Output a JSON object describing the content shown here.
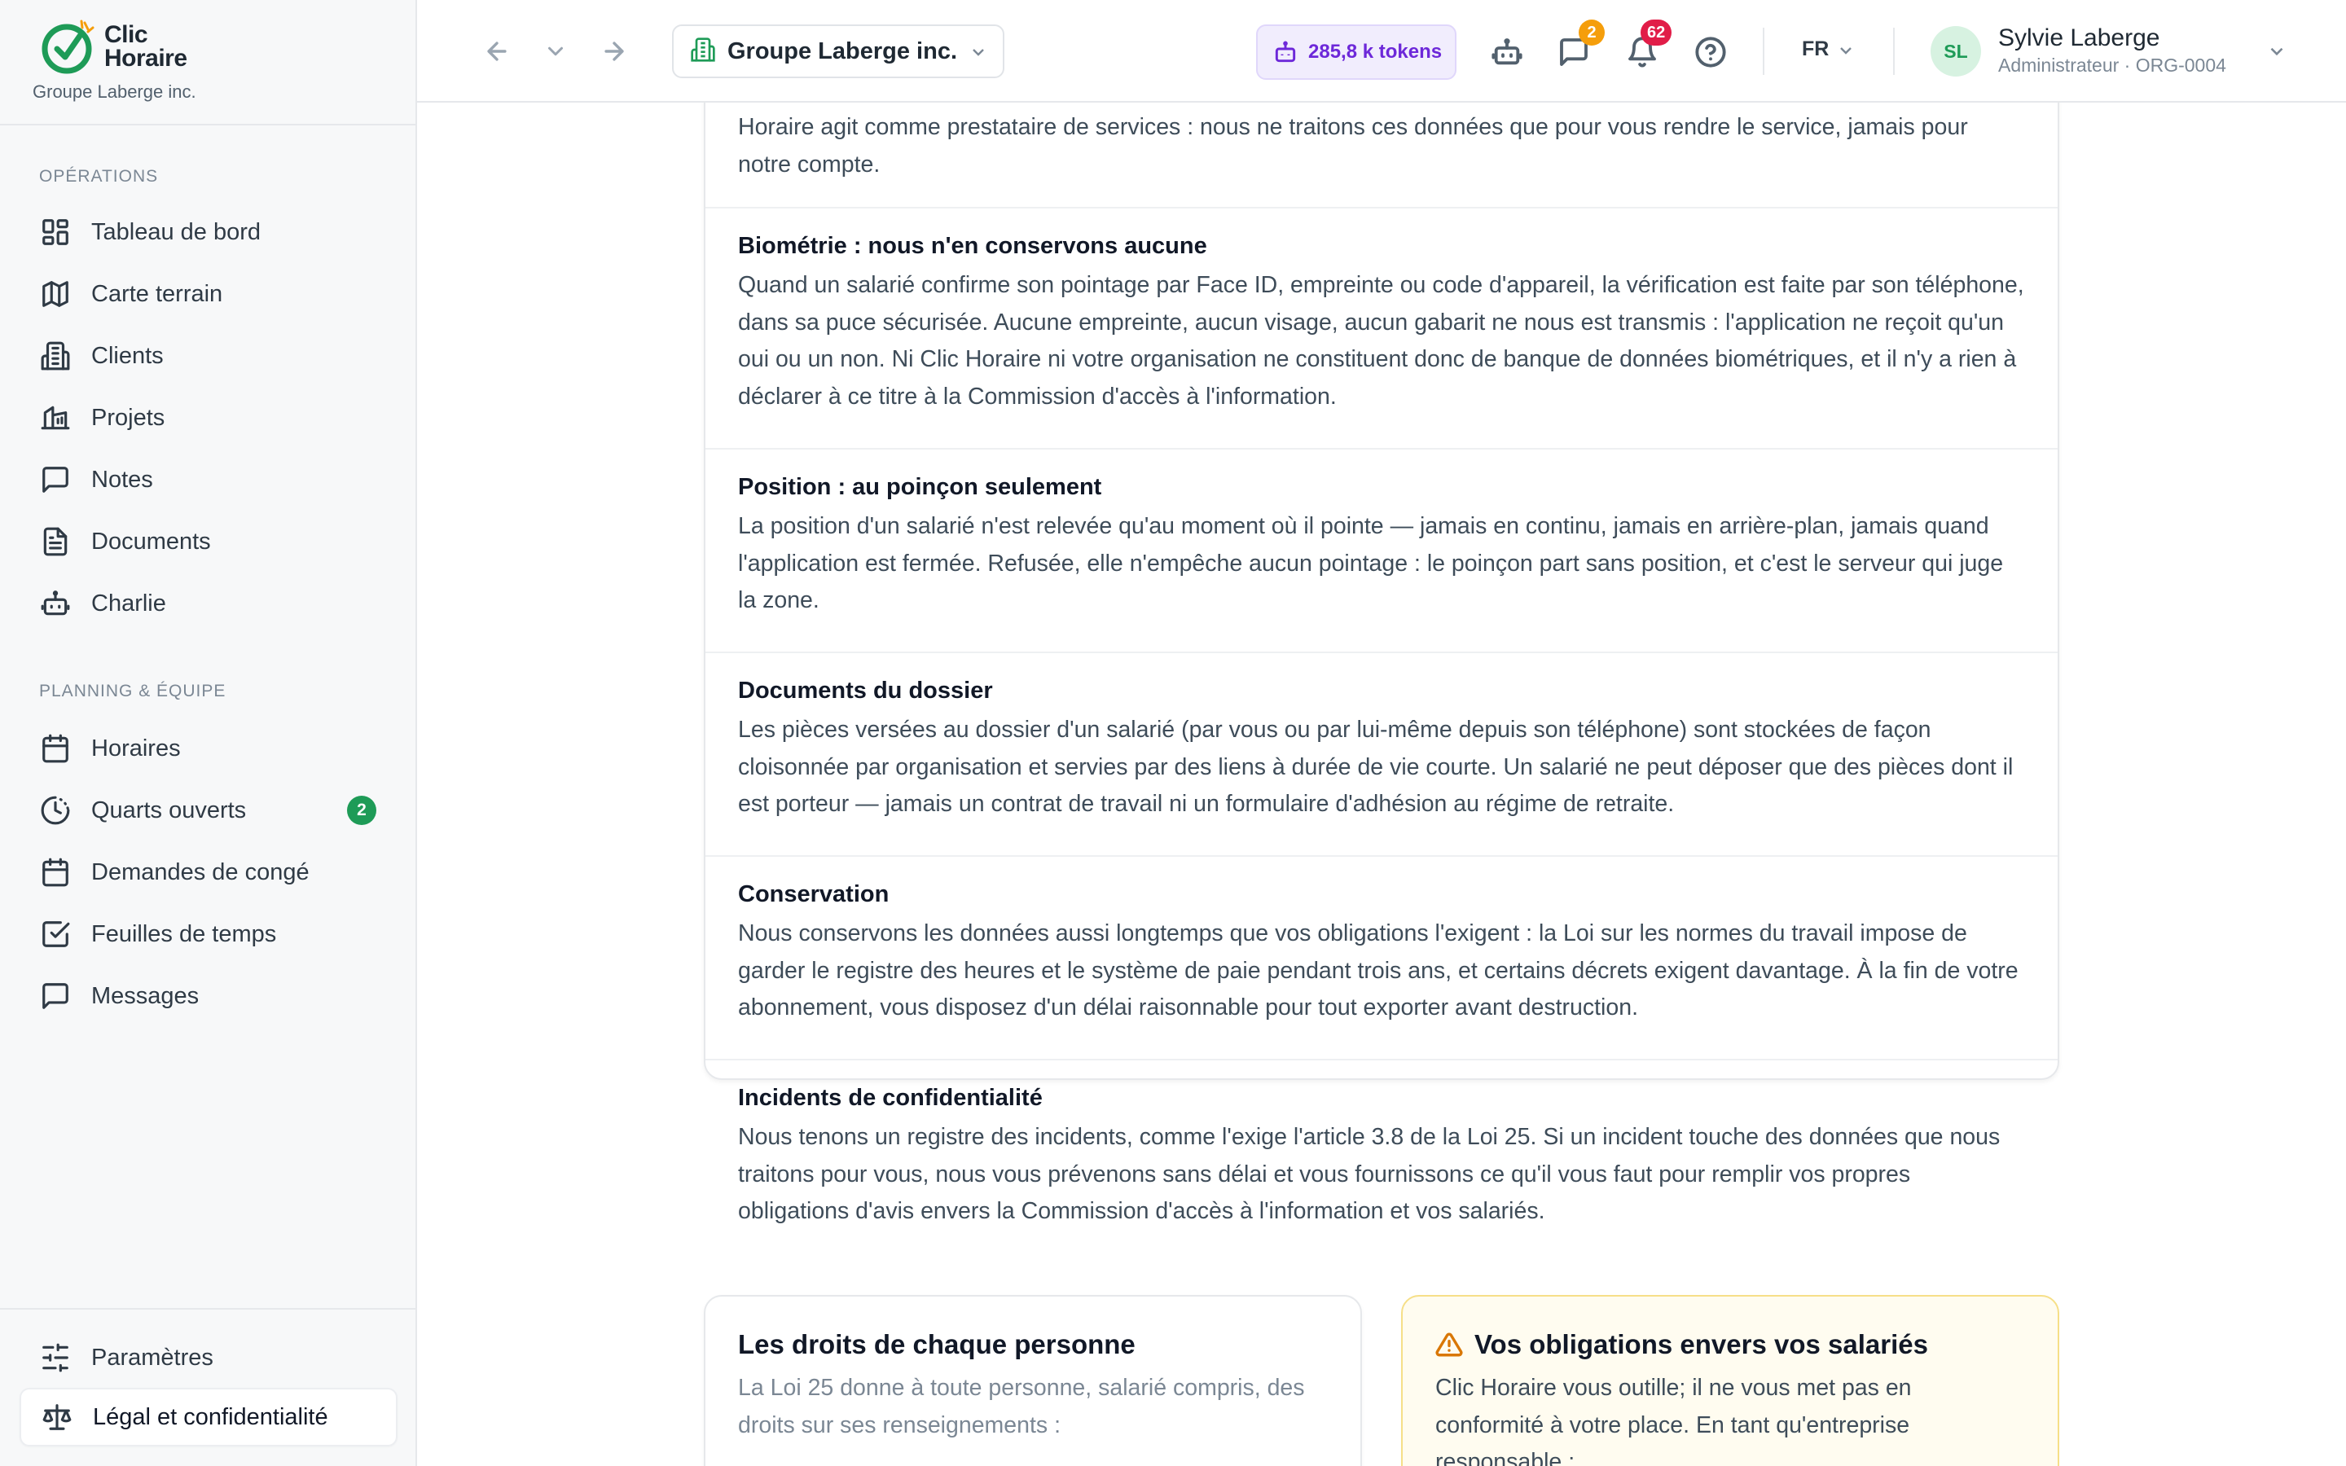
{
  "brand": {
    "name_line1": "Clic",
    "name_line2": "Horaire",
    "org": "Groupe Laberge inc.",
    "accent": "#1e9b57"
  },
  "sidebar": {
    "sections": [
      {
        "title": "Opérations",
        "items": [
          {
            "label": "Tableau de bord",
            "icon": "dashboard-icon"
          },
          {
            "label": "Carte terrain",
            "icon": "map-icon"
          },
          {
            "label": "Clients",
            "icon": "building-icon"
          },
          {
            "label": "Projets",
            "icon": "folder-icon"
          },
          {
            "label": "Notes",
            "icon": "message-square-icon"
          },
          {
            "label": "Documents",
            "icon": "file-text-icon"
          },
          {
            "label": "Charlie",
            "icon": "bot-icon"
          }
        ]
      },
      {
        "title": "Planning & équipe",
        "items": [
          {
            "label": "Horaires",
            "icon": "calendar-icon"
          },
          {
            "label": "Quarts ouverts",
            "icon": "clock-icon",
            "badge": "2"
          },
          {
            "label": "Demandes de congé",
            "icon": "calendar-icon"
          },
          {
            "label": "Feuilles de temps",
            "icon": "check-square-icon"
          },
          {
            "label": "Messages",
            "icon": "message-square-icon"
          }
        ]
      }
    ],
    "footer_items": [
      {
        "label": "Paramètres",
        "icon": "sliders-icon"
      },
      {
        "label": "Légal et confidentialité",
        "icon": "scale-icon",
        "active": true
      }
    ]
  },
  "topbar": {
    "org_selector": "Groupe Laberge inc.",
    "tokens": "285,8 k tokens",
    "messages_badge": "2",
    "notifications_badge": "62",
    "language": "FR",
    "user": {
      "initials": "SL",
      "name": "Sylvie Laberge",
      "role": "Administrateur · ORG-0004"
    }
  },
  "content": {
    "partial_intro": "Horaire agit comme prestataire de services : nous ne traitons ces données que pour vous rendre le service, jamais pour notre compte.",
    "sections": [
      {
        "title": "Biométrie : nous n'en conservons aucune",
        "body": "Quand un salarié confirme son pointage par Face ID, empreinte ou code d'appareil, la vérification est faite par son téléphone, dans sa puce sécurisée. Aucune empreinte, aucun visage, aucun gabarit ne nous est transmis : l'application ne reçoit qu'un oui ou un non. Ni Clic Horaire ni votre organisation ne constituent donc de banque de données biométriques, et il n'y a rien à déclarer à ce titre à la Commission d'accès à l'information."
      },
      {
        "title": "Position : au poinçon seulement",
        "body": "La position d'un salarié n'est relevée qu'au moment où il pointe — jamais en continu, jamais en arrière-plan, jamais quand l'application est fermée. Refusée, elle n'empêche aucun pointage : le poinçon part sans position, et c'est le serveur qui juge la zone."
      },
      {
        "title": "Documents du dossier",
        "body": "Les pièces versées au dossier d'un salarié (par vous ou par lui-même depuis son téléphone) sont stockées de façon cloisonnée par organisation et servies par des liens à durée de vie courte. Un salarié ne peut déposer que des pièces dont il est porteur — jamais un contrat de travail ni un formulaire d'adhésion au régime de retraite."
      },
      {
        "title": "Conservation",
        "body": "Nous conservons les données aussi longtemps que vos obligations l'exigent : la Loi sur les normes du travail impose de garder le registre des heures et le système de paie pendant trois ans, et certains décrets exigent davantage. À la fin de votre abonnement, vous disposez d'un délai raisonnable pour tout exporter avant destruction."
      },
      {
        "title": "Incidents de confidentialité",
        "body": "Nous tenons un registre des incidents, comme l'exige l'article 3.8 de la Loi 25. Si un incident touche des données que nous traitons pour vous, nous vous prévenons sans délai et vous fournissons ce qu'il vous faut pour remplir vos propres obligations d'avis envers la Commission d'accès à l'information et vos salariés."
      }
    ],
    "rights_card": {
      "title": "Les droits de chaque personne",
      "body": "La Loi 25 donne à toute personne, salarié compris, des droits sur ses renseignements :"
    },
    "obligations_card": {
      "title": "Vos obligations envers vos salariés",
      "icon": "alert-triangle-icon",
      "body": "Clic Horaire vous outille; il ne vous met pas en conformité à votre place. En tant qu'entreprise responsable :"
    }
  }
}
